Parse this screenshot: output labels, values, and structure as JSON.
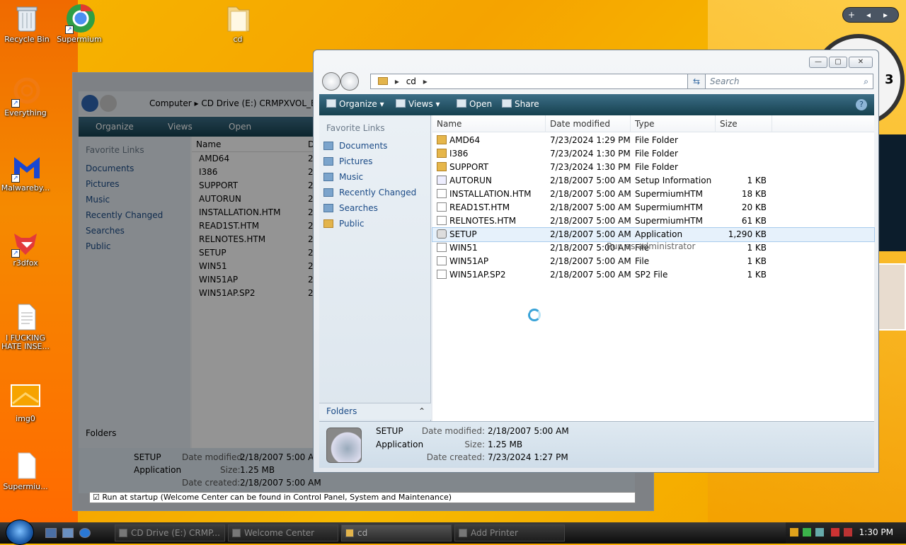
{
  "desktop": {
    "icons": [
      {
        "label": "Recycle Bin",
        "icon": "recycle-bin-icon"
      },
      {
        "label": "Supermium",
        "icon": "supermium-icon"
      },
      {
        "label": "cd",
        "icon": "folder-icon"
      },
      {
        "label": "Everything",
        "icon": "everything-icon"
      },
      {
        "label": "Malwareby...",
        "icon": "malwarebytes-icon"
      },
      {
        "label": "r3dfox",
        "icon": "r3dfox-icon"
      },
      {
        "label": "I FUCKING HATE INSE...",
        "icon": "text-file-icon"
      },
      {
        "label": "img0",
        "icon": "image-file-icon"
      },
      {
        "label": "Supermiu...",
        "icon": "file-icon"
      }
    ]
  },
  "gadgets": {
    "plus": "+",
    "prev": "◂",
    "next": "▸",
    "clock_digit": "3"
  },
  "back_window": {
    "address": [
      "Computer",
      "CD Drive (E:) CRMPXVOL_E"
    ],
    "toolbar": {
      "organize": "Organize",
      "views": "Views",
      "open": "Open"
    },
    "favorite_links_title": "Favorite Links",
    "links": [
      "Documents",
      "Pictures",
      "Music",
      "Recently Changed",
      "Searches",
      "Public"
    ],
    "col_name": "Name",
    "col_date_partial": "D",
    "files": [
      "AMD64",
      "I386",
      "SUPPORT",
      "AUTORUN",
      "INSTALLATION.HTM",
      "READ1ST.HTM",
      "RELNOTES.HTM",
      "SETUP",
      "WIN51",
      "WIN51AP",
      "WIN51AP.SP2"
    ],
    "date_partial": "2",
    "folders_label": "Folders",
    "details": {
      "name": "SETUP",
      "type": "Application",
      "modified_label": "Date modified:",
      "modified": "2/18/2007 5:00 AM",
      "size_label": "Size:",
      "size": "1.25 MB",
      "created_label": "Date created:",
      "created": "2/18/2007 5:00 AM"
    },
    "startup_check": "Run at startup (Welcome Center can be found in Control Panel, System and Maintenance)"
  },
  "window": {
    "address": "cd",
    "search_placeholder": "Search",
    "toolbar": {
      "organize": "Organize",
      "views": "Views",
      "open": "Open",
      "share": "Share"
    },
    "favorite_links_title": "Favorite Links",
    "links": [
      {
        "label": "Documents",
        "icon": "documents-icon"
      },
      {
        "label": "Pictures",
        "icon": "pictures-icon"
      },
      {
        "label": "Music",
        "icon": "music-icon"
      },
      {
        "label": "Recently Changed",
        "icon": "recently-changed-icon"
      },
      {
        "label": "Searches",
        "icon": "searches-icon"
      },
      {
        "label": "Public",
        "icon": "public-folder-icon"
      }
    ],
    "folders_label": "Folders",
    "columns": [
      "Name",
      "Date modified",
      "Type",
      "Size"
    ],
    "files": [
      {
        "name": "AMD64",
        "date": "7/23/2024 1:29 PM",
        "type": "File Folder",
        "size": "",
        "kind": "folder"
      },
      {
        "name": "I386",
        "date": "7/23/2024 1:30 PM",
        "type": "File Folder",
        "size": "",
        "kind": "folder"
      },
      {
        "name": "SUPPORT",
        "date": "7/23/2024 1:30 PM",
        "type": "File Folder",
        "size": "",
        "kind": "folder"
      },
      {
        "name": "AUTORUN",
        "date": "2/18/2007 5:00 AM",
        "type": "Setup Information",
        "size": "1 KB",
        "kind": "inf"
      },
      {
        "name": "INSTALLATION.HTM",
        "date": "2/18/2007 5:00 AM",
        "type": "SupermiumHTM",
        "size": "18 KB",
        "kind": "file"
      },
      {
        "name": "READ1ST.HTM",
        "date": "2/18/2007 5:00 AM",
        "type": "SupermiumHTM",
        "size": "20 KB",
        "kind": "file"
      },
      {
        "name": "RELNOTES.HTM",
        "date": "2/18/2007 5:00 AM",
        "type": "SupermiumHTM",
        "size": "61 KB",
        "kind": "file"
      },
      {
        "name": "SETUP",
        "date": "2/18/2007 5:00 AM",
        "type": "Application",
        "size": "1,290 KB",
        "kind": "app"
      },
      {
        "name": "WIN51",
        "date": "2/18/2007 5:00 AM",
        "type": "File",
        "size": "1 KB",
        "kind": "file"
      },
      {
        "name": "WIN51AP",
        "date": "2/18/2007 5:00 AM",
        "type": "File",
        "size": "1 KB",
        "kind": "file"
      },
      {
        "name": "WIN51AP.SP2",
        "date": "2/18/2007 5:00 AM",
        "type": "SP2 File",
        "size": "1 KB",
        "kind": "file"
      }
    ],
    "selected_index": 7,
    "context_hint": "Run as administrator",
    "details": {
      "name": "SETUP",
      "type": "Application",
      "modified_label": "Date modified:",
      "modified": "2/18/2007 5:00 AM",
      "size_label": "Size:",
      "size": "1.25 MB",
      "created_label": "Date created:",
      "created": "7/23/2024 1:27 PM"
    }
  },
  "taskbar": {
    "buttons": [
      {
        "label": "CD Drive (E:) CRMP...",
        "active": false
      },
      {
        "label": "Welcome Center",
        "active": false
      },
      {
        "label": "cd",
        "active": true
      },
      {
        "label": "Add Printer",
        "active": false
      }
    ],
    "time": "1:30 PM"
  }
}
